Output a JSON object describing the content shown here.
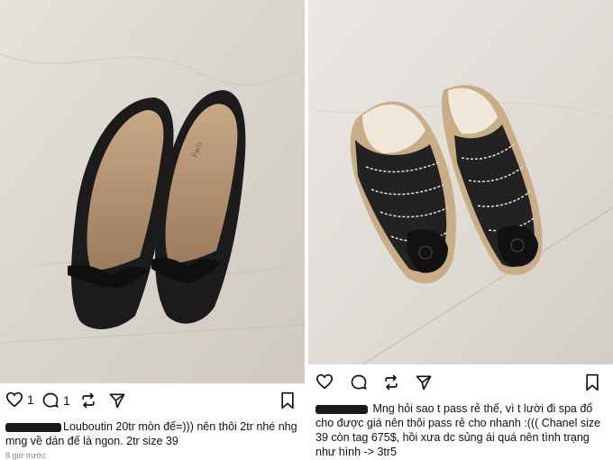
{
  "left_post": {
    "likes": "1",
    "comments": "1",
    "caption_main": "Louboutin 20tr mòn đế=))) nên thôi 2tr nhé nhg",
    "caption_line2": "mng về dán đế là ngon. 2tr size 39",
    "time": "8 giờ trước",
    "shoe_brand_insole": "Paris"
  },
  "right_post": {
    "caption_line1": "Mng hỏi sao t pass rẻ thế, vì t lười đi spa đổ",
    "caption_line2": "cho được giá nên thôi pass rẻ cho nhanh :((( Chanel size",
    "caption_line3": "39 còn tag 675$, hồi xưa dc sủng ái quá nên tình trạng",
    "caption_line4": "như hình -> 3tr5"
  },
  "icons": [
    "heart-icon",
    "comment-icon",
    "repost-icon",
    "share-icon",
    "bookmark-icon"
  ],
  "colors": {
    "text": "#111111",
    "redaction": "#1a1a1a",
    "muted": "#888888"
  }
}
